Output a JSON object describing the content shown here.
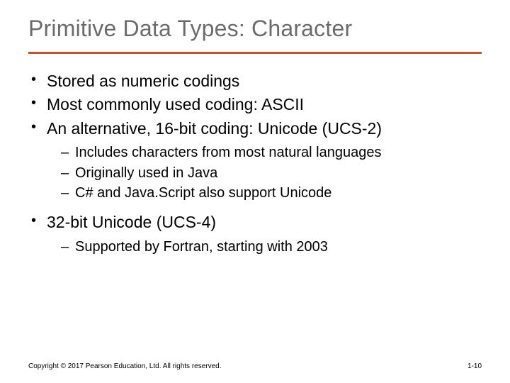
{
  "title": "Primitive Data Types: Character",
  "bullets": {
    "b0": "Stored as numeric codings",
    "b1": "Most commonly used coding: ASCII",
    "b2": "An alternative, 16-bit coding: Unicode (UCS-2)",
    "b2_sub": {
      "s0": "Includes characters from most natural languages",
      "s1": "Originally used in Java",
      "s2": "C# and Java.Script also support Unicode"
    },
    "b3": "32-bit Unicode (UCS-4)",
    "b3_sub": {
      "s0": "Supported by Fortran, starting with 2003"
    }
  },
  "footer": {
    "copyright": "Copyright © 2017 Pearson Education, Ltd. All rights reserved.",
    "page": "1-10"
  }
}
